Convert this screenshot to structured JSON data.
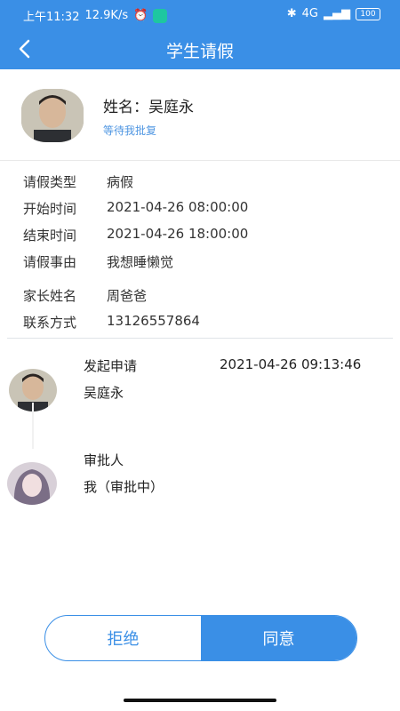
{
  "status_bar": {
    "time": "上午11:32",
    "speed": "12.9K/s",
    "signal": "4G",
    "battery": "100"
  },
  "header": {
    "title": "学生请假"
  },
  "profile": {
    "name": "姓名：吴庭永",
    "status": "等待我批复"
  },
  "fields": [
    {
      "label": "请假类型",
      "value": "病假"
    },
    {
      "label": "开始时间",
      "value": "2021-04-26 08:00:00"
    },
    {
      "label": "结束时间",
      "value": "2021-04-26 18:00:00"
    },
    {
      "label": "请假事由",
      "value": "我想睡懒觉"
    },
    {
      "label": "家长姓名",
      "value": "周爸爸"
    },
    {
      "label": "联系方式",
      "value": "13126557864"
    }
  ],
  "timeline": {
    "step1": {
      "title": "发起申请",
      "time": "2021-04-26 09:13:46",
      "person": "吴庭永"
    },
    "step2": {
      "title": "审批人",
      "person": "我（审批中）"
    }
  },
  "actions": {
    "reject_label": "拒绝",
    "agree_label": "同意"
  },
  "colors": {
    "primary": "#3a8fe6",
    "status_text": "#4f96e2"
  }
}
